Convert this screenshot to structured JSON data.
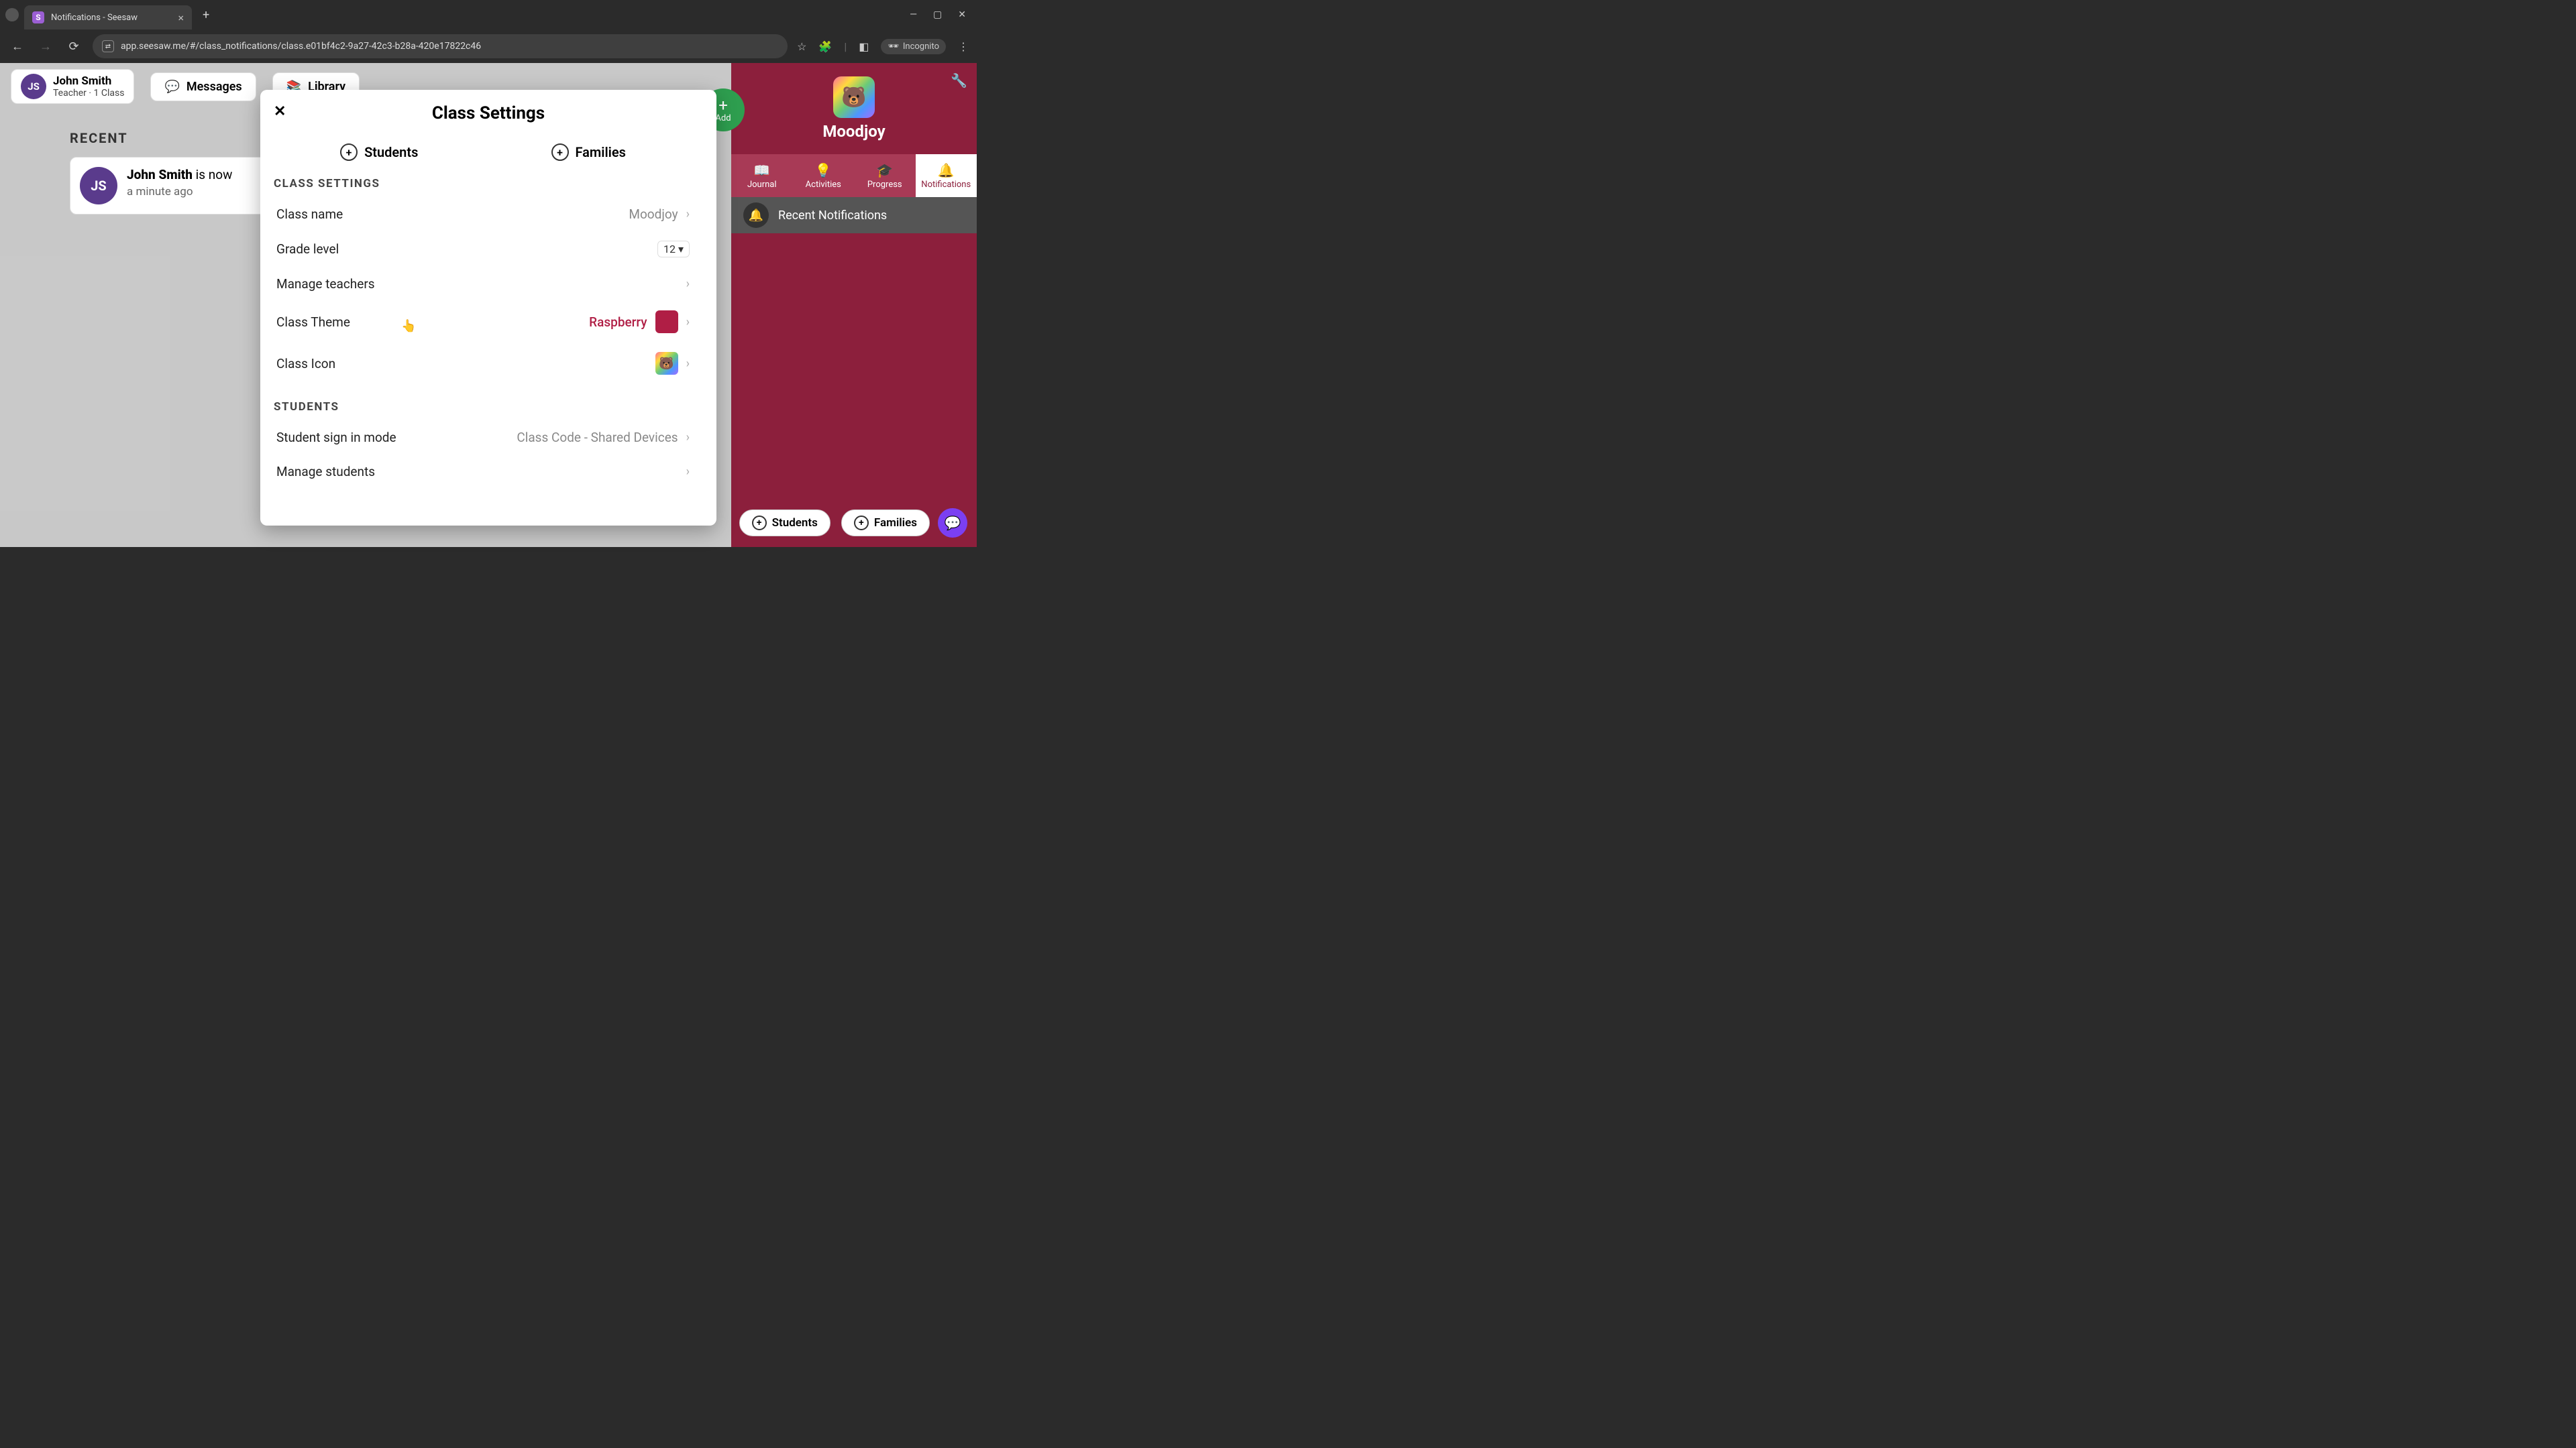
{
  "browser": {
    "tab_title": "Notifications - Seesaw",
    "url": "app.seesaw.me/#/class_notifications/class.e01bf4c2-9a27-42c3-b28a-420e17822c46",
    "incognito_label": "Incognito"
  },
  "header": {
    "teacher_initials": "JS",
    "teacher_name": "John Smith",
    "teacher_role": "Teacher · 1 Class",
    "messages_label": "Messages",
    "library_label": "Library"
  },
  "recent": {
    "title": "RECENT",
    "item_initials": "JS",
    "item_who_bold": "John Smith",
    "item_who_rest": " is now",
    "item_when": "a minute ago"
  },
  "class_panel": {
    "add_fab_label": "Add",
    "class_name": "Moodjoy",
    "tabs": {
      "journal": "Journal",
      "activities": "Activities",
      "progress": "Progress",
      "notifications": "Notifications"
    },
    "notif_strip_title": "Recent Notifications"
  },
  "bottom": {
    "students_label": "Students",
    "families_label": "Families"
  },
  "modal": {
    "title": "Class Settings",
    "add_students": "Students",
    "add_families": "Families",
    "section_class_settings": "CLASS SETTINGS",
    "rows": {
      "class_name_label": "Class name",
      "class_name_value": "Moodjoy",
      "grade_label": "Grade level",
      "grade_value": "12",
      "manage_teachers_label": "Manage teachers",
      "theme_label": "Class Theme",
      "theme_value": "Raspberry",
      "theme_color": "#b01e45",
      "icon_label": "Class Icon"
    },
    "section_students": "STUDENTS",
    "student_rows": {
      "signin_label": "Student sign in mode",
      "signin_value": "Class Code - Shared Devices",
      "manage_students_label": "Manage students"
    }
  }
}
